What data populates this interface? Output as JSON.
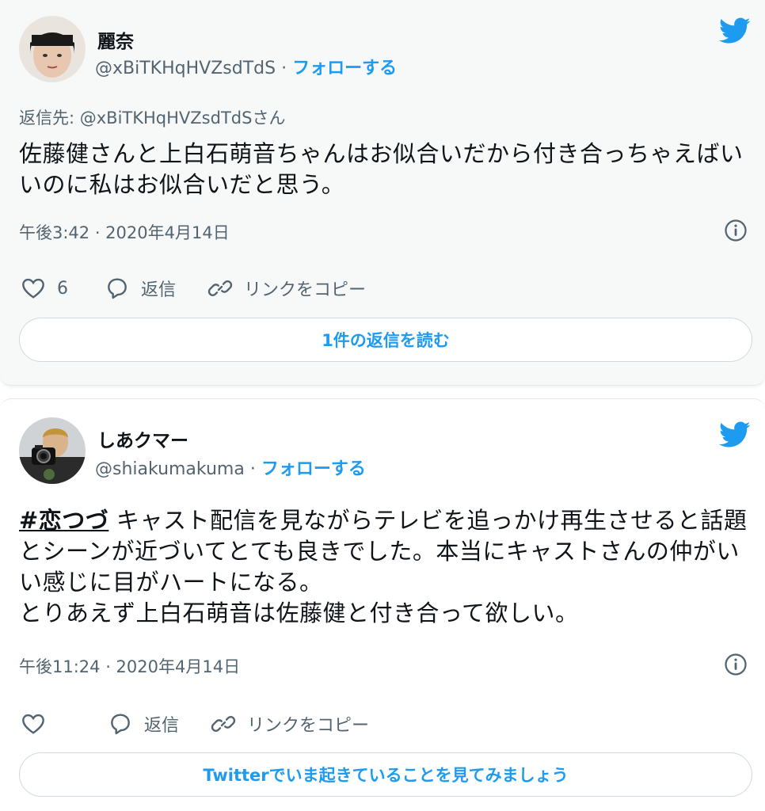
{
  "tweets": [
    {
      "display_name": "麗奈",
      "handle": "@xBiTKHqHVZsdTdS",
      "separator": "·",
      "follow_label": "フォローする",
      "reply_to": "返信先: @xBiTKHqHVZsdTdSさん",
      "text": "佐藤健さんと上白石萌音ちゃんはお似合いだから付き合っちゃえばいいのに私はお似合いだと思う。",
      "timestamp": "午後3:42 · 2020年4月14日",
      "like_count": "6",
      "reply_label": "返信",
      "copy_link_label": "リンクをコピー",
      "pill_label": "1件の返信を読む"
    },
    {
      "display_name": "しあクマー",
      "handle": "@shiakumakuma",
      "separator": "·",
      "follow_label": "フォローする",
      "hashtag": "#恋つづ",
      "text": " キャスト配信を見ながらテレビを追っかけ再生させると話題とシーンが近づいてとても良きでした。本当にキャストさんの仲がいい感じに目がハートになる。\nとりあえず上白石萌音は佐藤健と付き合って欲しい。",
      "timestamp": "午後11:24 · 2020年4月14日",
      "reply_label": "返信",
      "copy_link_label": "リンクをコピー",
      "pill_label": "Twitterでいま起きていることを見てみましょう"
    }
  ],
  "colors": {
    "accent": "#1d9bf0",
    "secondary_text": "#536471",
    "primary_text": "#0f1419"
  },
  "icons": {
    "brand": "twitter-bird-icon",
    "like": "heart-icon",
    "reply": "speech-bubble-icon",
    "copy_link": "link-icon",
    "info": "info-icon"
  }
}
